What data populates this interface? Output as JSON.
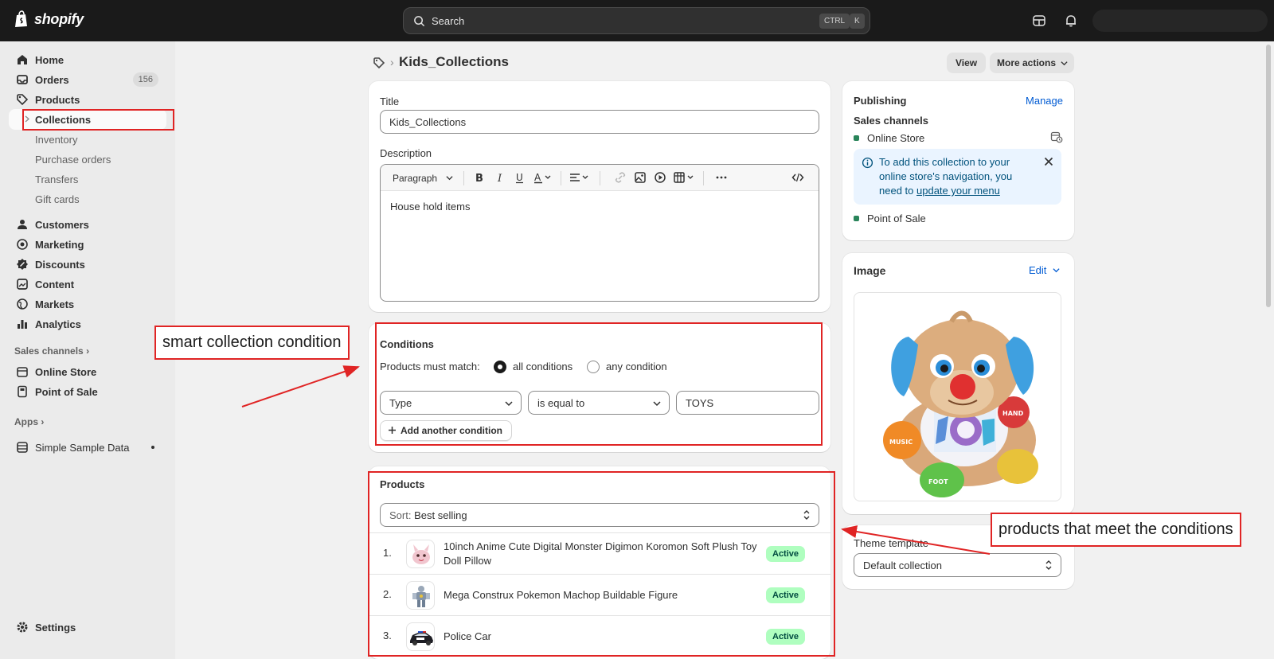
{
  "topbar": {
    "brand": "shopify",
    "search_placeholder": "Search",
    "shortcut_ctrl": "CTRL",
    "shortcut_key": "K"
  },
  "sidebar": {
    "items": [
      {
        "label": "Home",
        "icon": "home-icon"
      },
      {
        "label": "Orders",
        "icon": "inbox-icon",
        "count": "156"
      },
      {
        "label": "Products",
        "icon": "tag-icon"
      },
      {
        "label": "Collections"
      },
      {
        "label": "Inventory"
      },
      {
        "label": "Purchase orders"
      },
      {
        "label": "Transfers"
      },
      {
        "label": "Gift cards"
      },
      {
        "label": "Customers",
        "icon": "person-icon"
      },
      {
        "label": "Marketing",
        "icon": "target-icon"
      },
      {
        "label": "Discounts",
        "icon": "discount-icon"
      },
      {
        "label": "Content",
        "icon": "content-icon"
      },
      {
        "label": "Markets",
        "icon": "globe-icon"
      },
      {
        "label": "Analytics",
        "icon": "chart-icon"
      }
    ],
    "sales_channels_title": "Sales channels",
    "channels": [
      {
        "label": "Online Store",
        "icon": "store-icon"
      },
      {
        "label": "Point of Sale",
        "icon": "pos-icon"
      }
    ],
    "apps_title": "Apps",
    "apps": [
      {
        "label": "Simple Sample Data",
        "icon": "database-icon"
      }
    ],
    "settings_label": "Settings"
  },
  "page": {
    "title": "Kids_Collections",
    "view_button": "View",
    "more_actions_button": "More actions"
  },
  "main": {
    "title_label": "Title",
    "title_value": "Kids_Collections",
    "description_label": "Description",
    "paragraph_dropdown": "Paragraph",
    "description_value": "House hold items",
    "conditions": {
      "heading": "Conditions",
      "match_label": "Products must match:",
      "option_all": "all conditions",
      "option_any": "any condition",
      "selected": "all conditions",
      "field": "Type",
      "operator": "is equal to",
      "value": "TOYS",
      "add_button": "Add another condition"
    },
    "products": {
      "heading": "Products",
      "sort_prefix": "Sort:",
      "sort_value": "Best selling",
      "rows": [
        {
          "num": "1.",
          "name": "10inch Anime Cute Digital Monster Digimon Koromon Soft Plush Toy Doll Pillow",
          "status": "Active"
        },
        {
          "num": "2.",
          "name": "Mega Construx Pokemon Machop Buildable Figure",
          "status": "Active"
        },
        {
          "num": "3.",
          "name": "Police Car",
          "status": "Active"
        }
      ]
    }
  },
  "right": {
    "publishing": {
      "heading": "Publishing",
      "manage_link": "Manage",
      "sales_channels_label": "Sales channels",
      "channel_1": "Online Store",
      "banner_text_pre": "To add this collection to your online store's navigation, you need to ",
      "banner_link": "update your menu",
      "channel_2": "Point of Sale"
    },
    "image": {
      "heading": "Image",
      "edit_link": "Edit"
    },
    "theme": {
      "label": "Theme template",
      "value": "Default collection"
    }
  },
  "annotations": {
    "smart_condition": "smart collection condition",
    "products_meet": "products that meet the conditions"
  },
  "colors": {
    "topbar": "#1a1a1a",
    "annotation_red": "#e02424",
    "badge_green": "#affebf",
    "link_blue": "#005bd3"
  }
}
